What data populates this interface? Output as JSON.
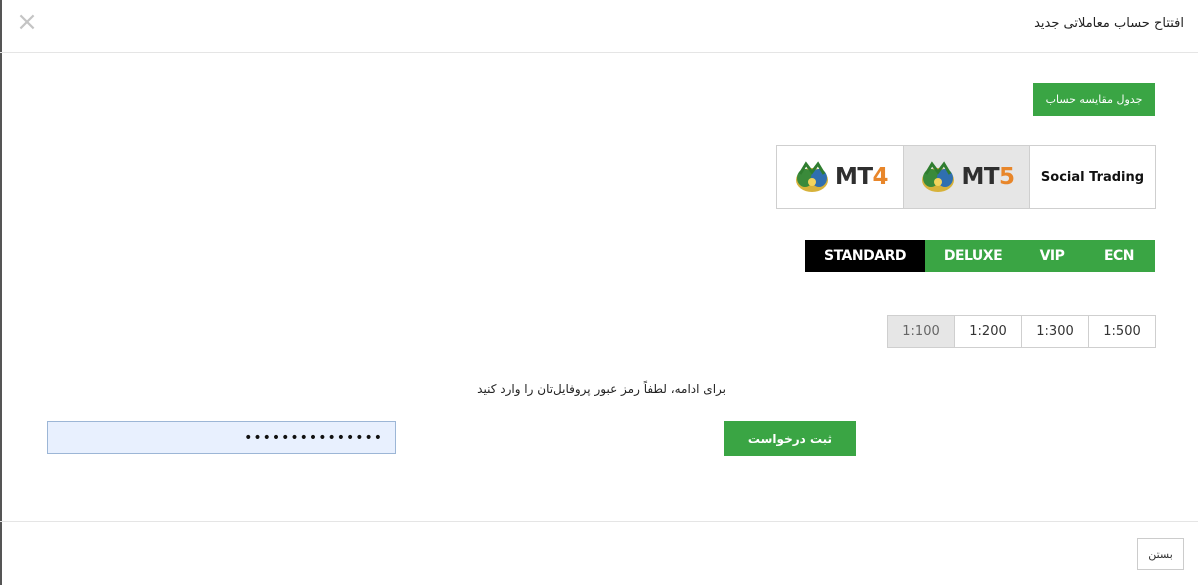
{
  "header": {
    "title": "افتتاح حساب معاملاتی جدید",
    "close_symbol": "×"
  },
  "compare_button": {
    "label": "جدول مقایسه حساب"
  },
  "platforms": [
    {
      "id": "mt4",
      "prefix": "MT",
      "number": "4",
      "selected": false,
      "icon": "metatrader-logo-icon"
    },
    {
      "id": "mt5",
      "prefix": "MT",
      "number": "5",
      "selected": true,
      "icon": "metatrader-logo-icon"
    },
    {
      "id": "social",
      "label": "Social Trading",
      "selected": false
    }
  ],
  "account_types": [
    {
      "label": "STANDARD",
      "active": true
    },
    {
      "label": "DELUXE",
      "active": false
    },
    {
      "label": "VIP",
      "active": false
    },
    {
      "label": "ECN",
      "active": false
    }
  ],
  "leverage_options": [
    {
      "label": "1:100",
      "selected": true
    },
    {
      "label": "1:200",
      "selected": false
    },
    {
      "label": "1:300",
      "selected": false
    },
    {
      "label": "1:500",
      "selected": false
    }
  ],
  "password": {
    "prompt": "برای ادامه، لطفاً رمز عبور پروفایل‌تان را وارد کنید",
    "value": "•••••••••••••••"
  },
  "submit_button": {
    "label": "ثبت درخواست"
  },
  "footer": {
    "close_label": "بستن"
  },
  "colors": {
    "accent_green": "#3aa544",
    "active_black": "#000000",
    "selected_gray": "#e6e6e6",
    "mt_number_orange": "#e8862a"
  }
}
